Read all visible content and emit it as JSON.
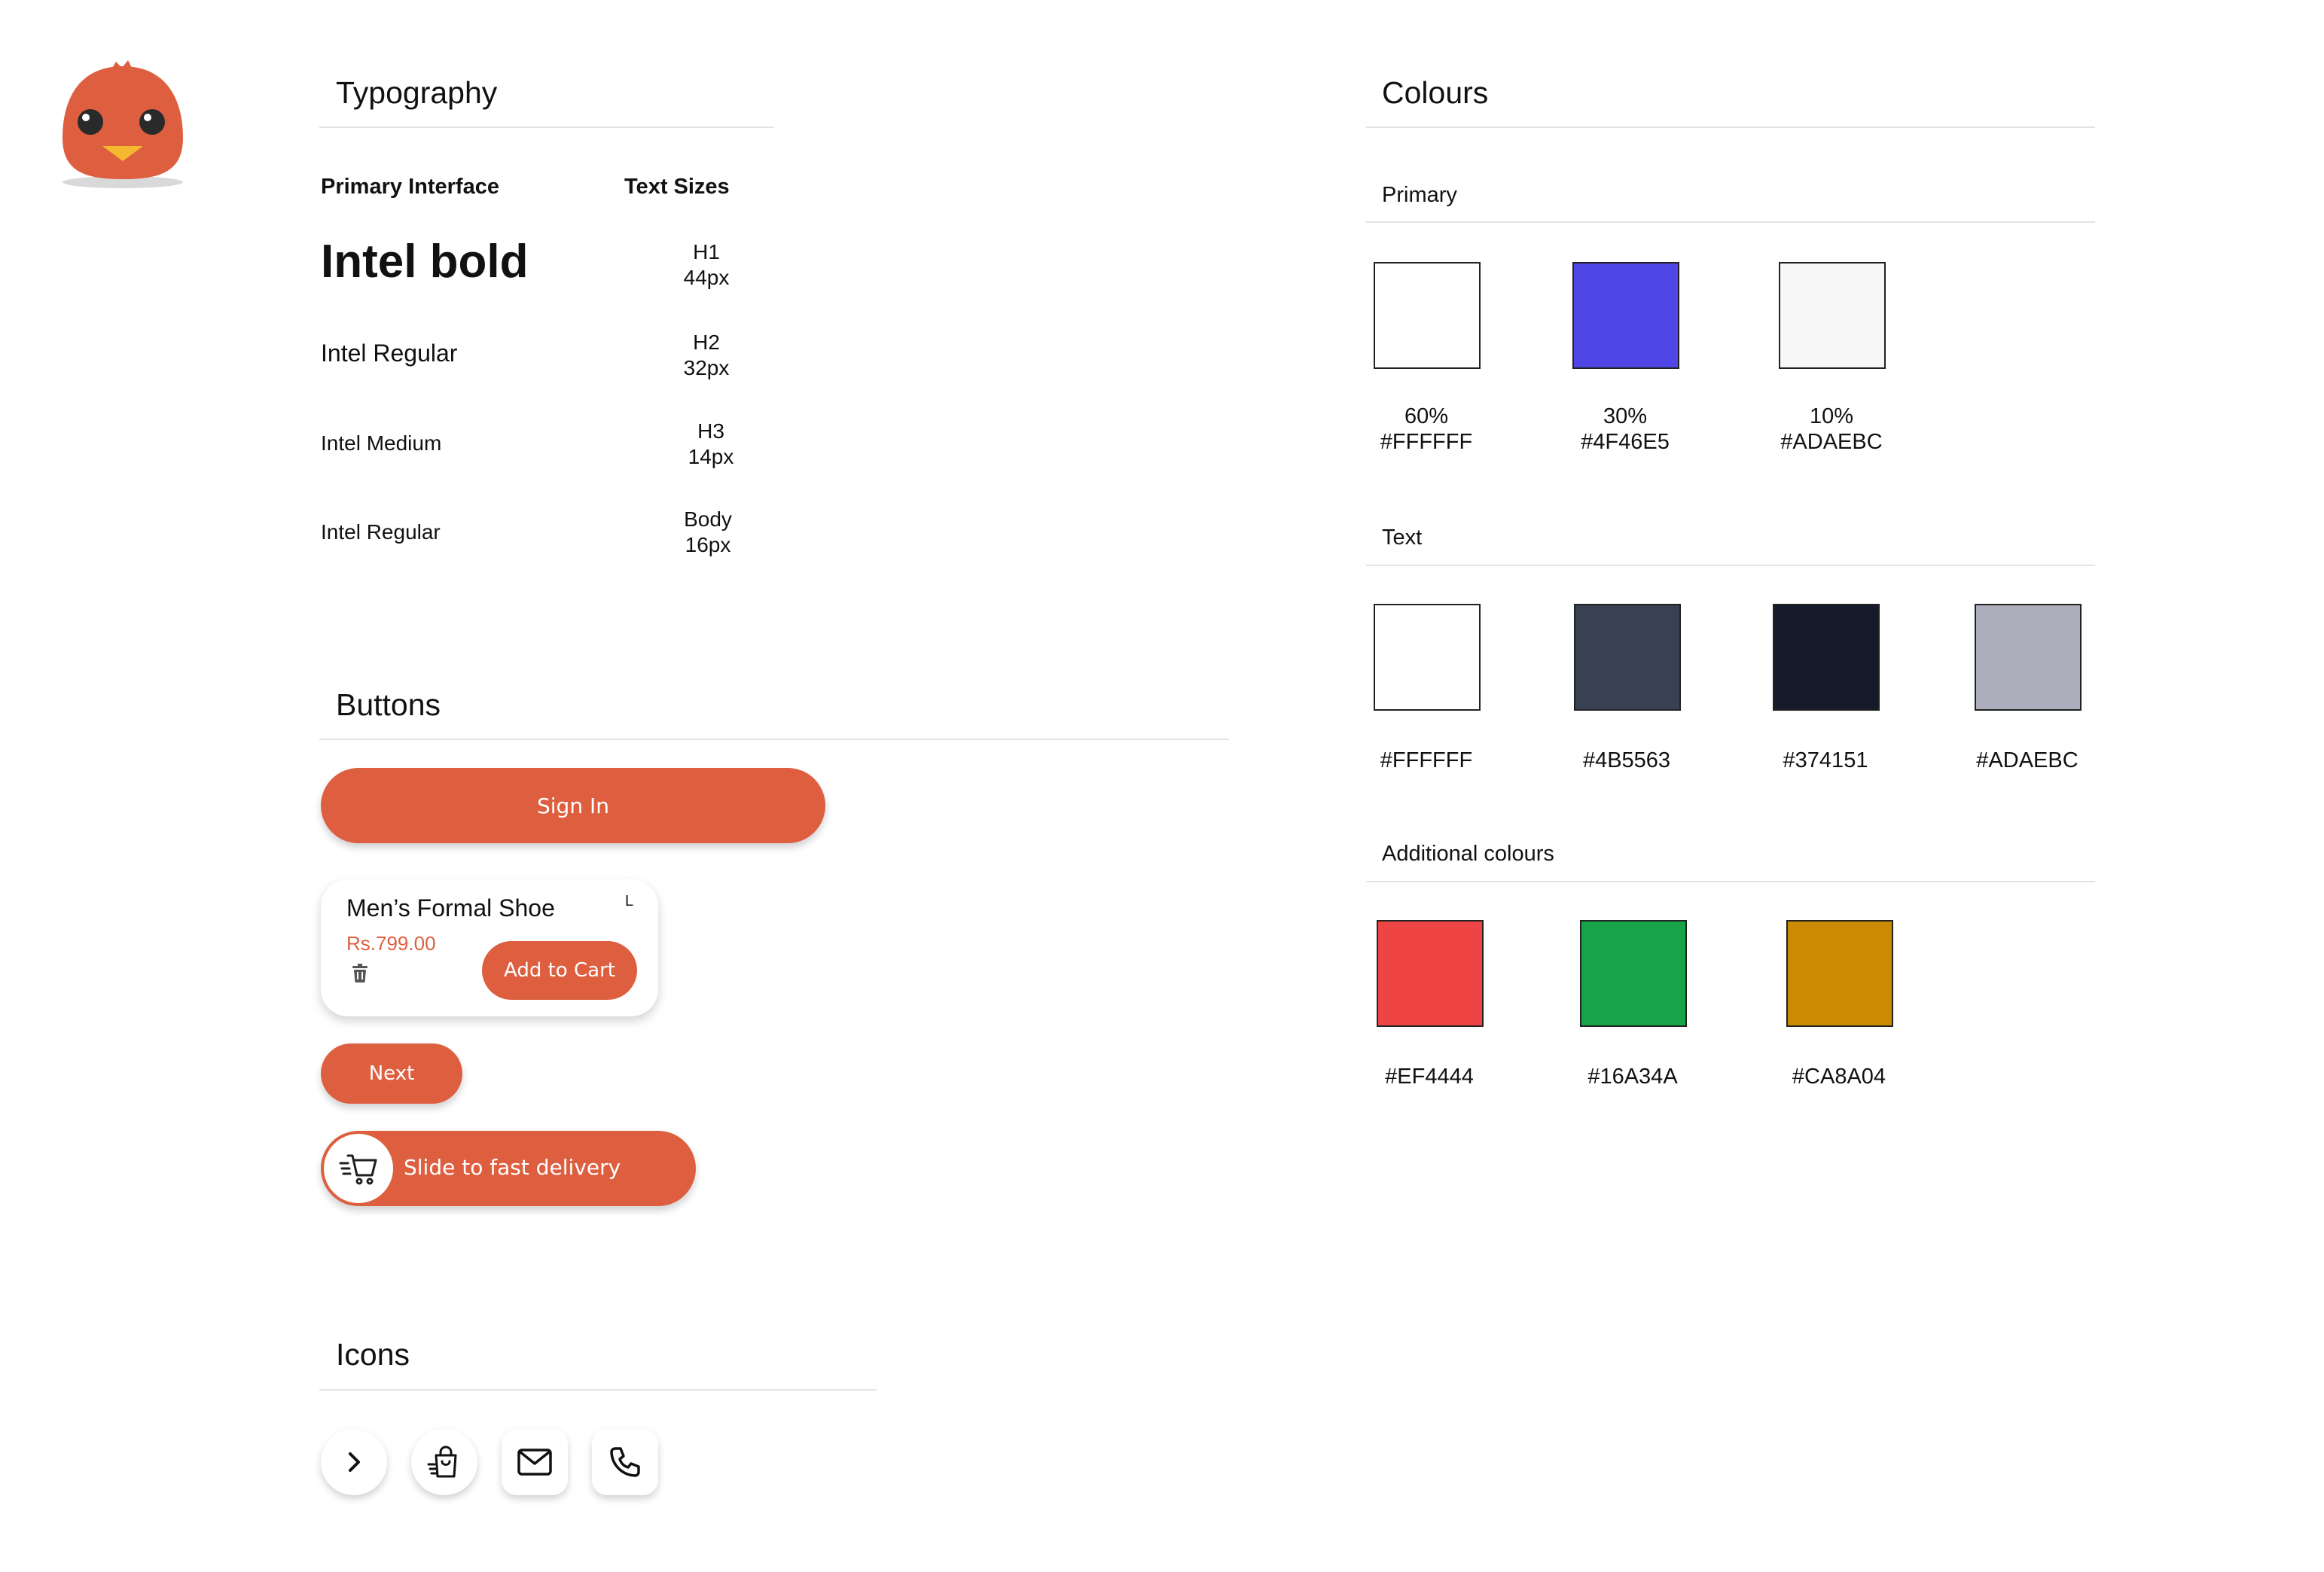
{
  "logo": {
    "name": "bird-mascot-logo",
    "colors": {
      "body": "#dd5f40",
      "beak": "#f5b82e",
      "eye": "#2a2a2a"
    }
  },
  "typography": {
    "title": "Typography",
    "col_primary": "Primary Interface",
    "col_sizes": "Text Sizes",
    "rows": [
      {
        "sample": "Intel bold",
        "size_name": "H1",
        "size": "44px"
      },
      {
        "sample": "Intel Regular",
        "size_name": "H2",
        "size": "32px"
      },
      {
        "sample": "Intel Medium",
        "size_name": "H3",
        "size": "14px"
      },
      {
        "sample": "Intel Regular",
        "size_name": "Body",
        "size": "16px"
      }
    ]
  },
  "buttons": {
    "title": "Buttons",
    "sign_in": "Sign In",
    "card": {
      "product": "Men’s Formal Shoe",
      "size": "L",
      "price": "Rs.799.00",
      "add_to_cart": "Add to Cart",
      "trash_icon": "trash-icon"
    },
    "next": "Next",
    "slide": {
      "label": "Slide to fast delivery",
      "icon": "fast-cart-icon"
    },
    "accent": "#dd5f40"
  },
  "icons": {
    "title": "Icons",
    "items": [
      "chevron-right-icon",
      "shopping-bag-icon",
      "mail-icon",
      "phone-icon"
    ]
  },
  "colours": {
    "title": "Colours",
    "primary": {
      "label": "Primary",
      "swatches": [
        {
          "hex": "#FFFFFF",
          "pct": "60%",
          "color": "#ffffff"
        },
        {
          "hex": "#4F46E5",
          "pct": "30%",
          "color": "#4f46e5"
        },
        {
          "hex": "#ADAEBC",
          "pct": "10%",
          "color": "#f7f7f7"
        }
      ]
    },
    "text": {
      "label": "Text",
      "swatches": [
        {
          "hex": "#FFFFFF",
          "color": "#ffffff"
        },
        {
          "hex": "#4B5563",
          "color": "#374151"
        },
        {
          "hex": "#374151",
          "color": "#151b28"
        },
        {
          "hex": "#ADAEBC",
          "color": "#adaebc"
        }
      ]
    },
    "additional": {
      "label": "Additional colours",
      "swatches": [
        {
          "hex": "#EF4444",
          "color": "#ef4444"
        },
        {
          "hex": "#16A34A",
          "color": "#16a34a"
        },
        {
          "hex": "#CA8A04",
          "color": "#ca8a04"
        }
      ]
    }
  }
}
